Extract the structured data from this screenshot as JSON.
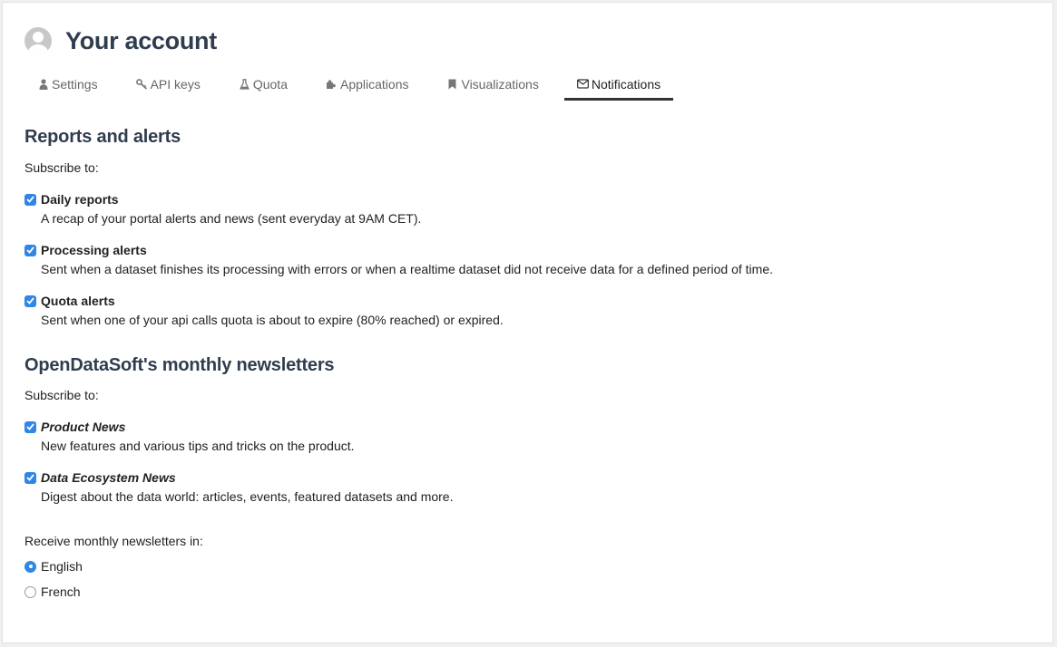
{
  "header": {
    "title": "Your account",
    "avatar_icon": "user-avatar-icon"
  },
  "tabs": [
    {
      "label": "Settings",
      "icon": "user-icon",
      "active": false
    },
    {
      "label": "API keys",
      "icon": "key-icon",
      "active": false
    },
    {
      "label": "Quota",
      "icon": "flask-icon",
      "active": false
    },
    {
      "label": "Applications",
      "icon": "puzzle-icon",
      "active": false
    },
    {
      "label": "Visualizations",
      "icon": "bookmark-icon",
      "active": false
    },
    {
      "label": "Notifications",
      "icon": "envelope-icon",
      "active": true
    }
  ],
  "reports": {
    "title": "Reports and alerts",
    "subscribe_label": "Subscribe to:",
    "options": [
      {
        "title": "Daily reports",
        "description": "A recap of your portal alerts and news (sent everyday at 9AM CET).",
        "checked": true
      },
      {
        "title": "Processing alerts",
        "description": "Sent when a dataset finishes its processing with errors or when a realtime dataset did not receive data for a defined period of time.",
        "checked": true
      },
      {
        "title": "Quota alerts",
        "description": "Sent when one of your api calls quota is about to expire (80% reached) or expired.",
        "checked": true
      }
    ]
  },
  "newsletters": {
    "title": "OpenDataSoft's monthly newsletters",
    "subscribe_label": "Subscribe to:",
    "options": [
      {
        "title": "Product News",
        "description": "New features and various tips and tricks on the product.",
        "checked": true
      },
      {
        "title": "Data Ecosystem News",
        "description": "Digest about the data world: articles, events, featured datasets and more.",
        "checked": true
      }
    ],
    "language_label": "Receive monthly newsletters in:",
    "languages": [
      {
        "label": "English",
        "selected": true
      },
      {
        "label": "French",
        "selected": false
      }
    ]
  },
  "colors": {
    "accent": "#2f86e6",
    "heading": "#2f3d4f",
    "active_tab_border": "#333333"
  }
}
